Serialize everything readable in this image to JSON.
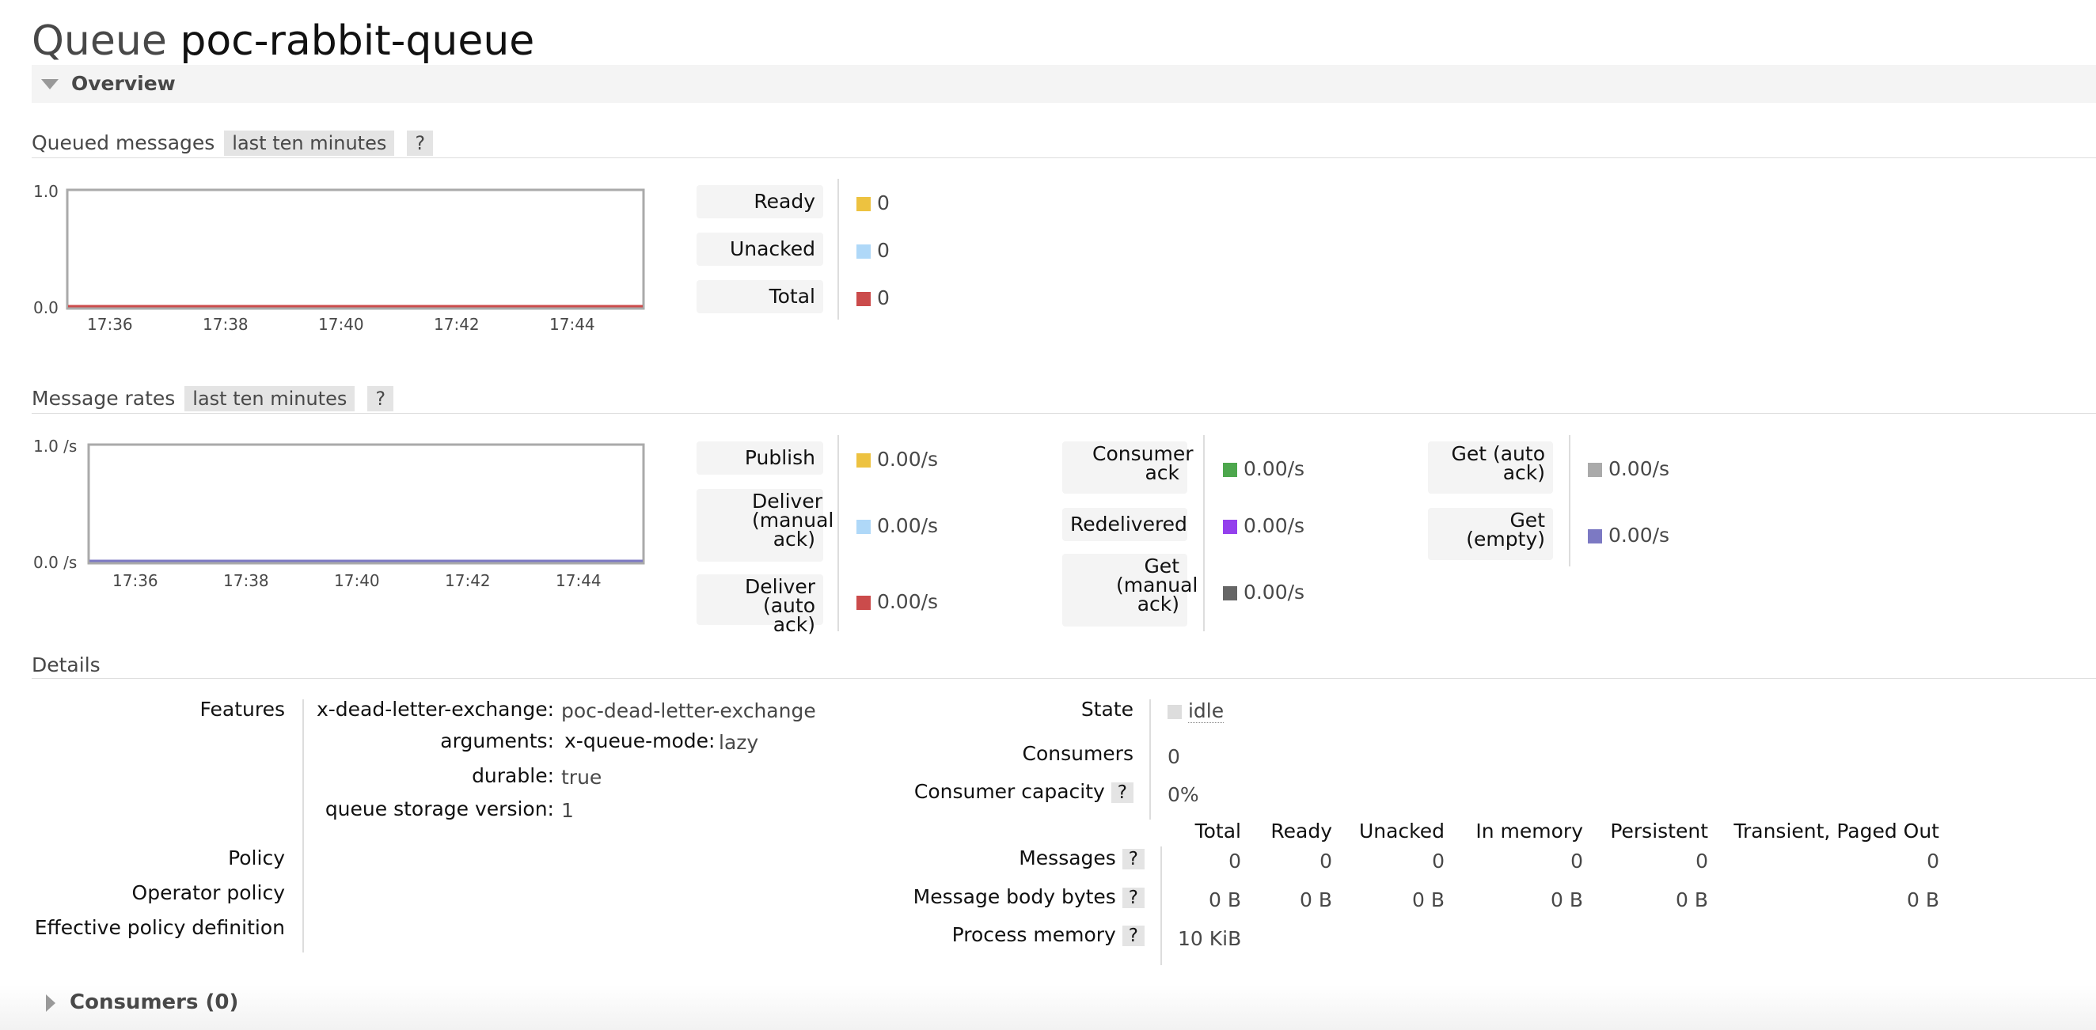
{
  "header": {
    "prefix": "Queue",
    "queue_name": "poc-rabbit-queue"
  },
  "overview": {
    "label": "Overview"
  },
  "queued_messages": {
    "title": "Queued messages",
    "range": "last ten minutes",
    "help": "?",
    "ylabels": [
      "1.0",
      "0.0"
    ],
    "xlabels": [
      "17:36",
      "17:38",
      "17:40",
      "17:42",
      "17:44"
    ],
    "legend": [
      {
        "label": "Ready",
        "value": "0",
        "color": "#edc240"
      },
      {
        "label": "Unacked",
        "value": "0",
        "color": "#afd8f8"
      },
      {
        "label": "Total",
        "value": "0",
        "color": "#cb4b4b"
      }
    ]
  },
  "message_rates": {
    "title": "Message rates",
    "range": "last ten minutes",
    "help": "?",
    "ylabels": [
      "1.0 /s",
      "0.0 /s"
    ],
    "xlabels": [
      "17:36",
      "17:38",
      "17:40",
      "17:42",
      "17:44"
    ],
    "col1": [
      {
        "label": "Publish",
        "value": "0.00/s",
        "color": "#edc240"
      },
      {
        "label": "Deliver (manual ack)",
        "value": "0.00/s",
        "color": "#afd8f8"
      },
      {
        "label": "Deliver (auto ack)",
        "value": "0.00/s",
        "color": "#cb4b4b"
      }
    ],
    "col2": [
      {
        "label": "Consumer ack",
        "value": "0.00/s",
        "color": "#4da74d"
      },
      {
        "label": "Redelivered",
        "value": "0.00/s",
        "color": "#9440ed"
      },
      {
        "label": "Get (manual ack)",
        "value": "0.00/s",
        "color": "#666666"
      }
    ],
    "col3": [
      {
        "label": "Get (auto ack)",
        "value": "0.00/s",
        "color": "#aaaaaa"
      },
      {
        "label": "Get (empty)",
        "value": "0.00/s",
        "color": "#7c79c3"
      }
    ]
  },
  "details": {
    "title": "Details",
    "features_label": "Features",
    "features": {
      "dlx_key": "x-dead-letter-exchange:",
      "dlx_val": "poc-dead-letter-exchange",
      "args_key": "arguments:",
      "args_sub_key": "x-queue-mode:",
      "args_sub_val": "lazy",
      "durable_key": "durable:",
      "durable_val": "true",
      "qsv_key": "queue storage version:",
      "qsv_val": "1"
    },
    "policy_label": "Policy",
    "operator_policy_label": "Operator policy",
    "effective_policy_label": "Effective policy definition",
    "state_label": "State",
    "state_value": "idle",
    "consumers_label": "Consumers",
    "consumers_value": "0",
    "capacity_label": "Consumer capacity",
    "capacity_value": "0%",
    "help": "?",
    "columns": [
      "Total",
      "Ready",
      "Unacked",
      "In memory",
      "Persistent",
      "Transient, Paged Out"
    ],
    "messages_label": "Messages",
    "messages": [
      "0",
      "0",
      "0",
      "0",
      "0",
      "0"
    ],
    "body_bytes_label": "Message body bytes",
    "body_bytes": [
      "0 B",
      "0 B",
      "0 B",
      "0 B",
      "0 B",
      "0 B"
    ],
    "process_memory_label": "Process memory",
    "process_memory": "10 KiB"
  },
  "consumers_section": {
    "label": "Consumers (0)"
  }
}
